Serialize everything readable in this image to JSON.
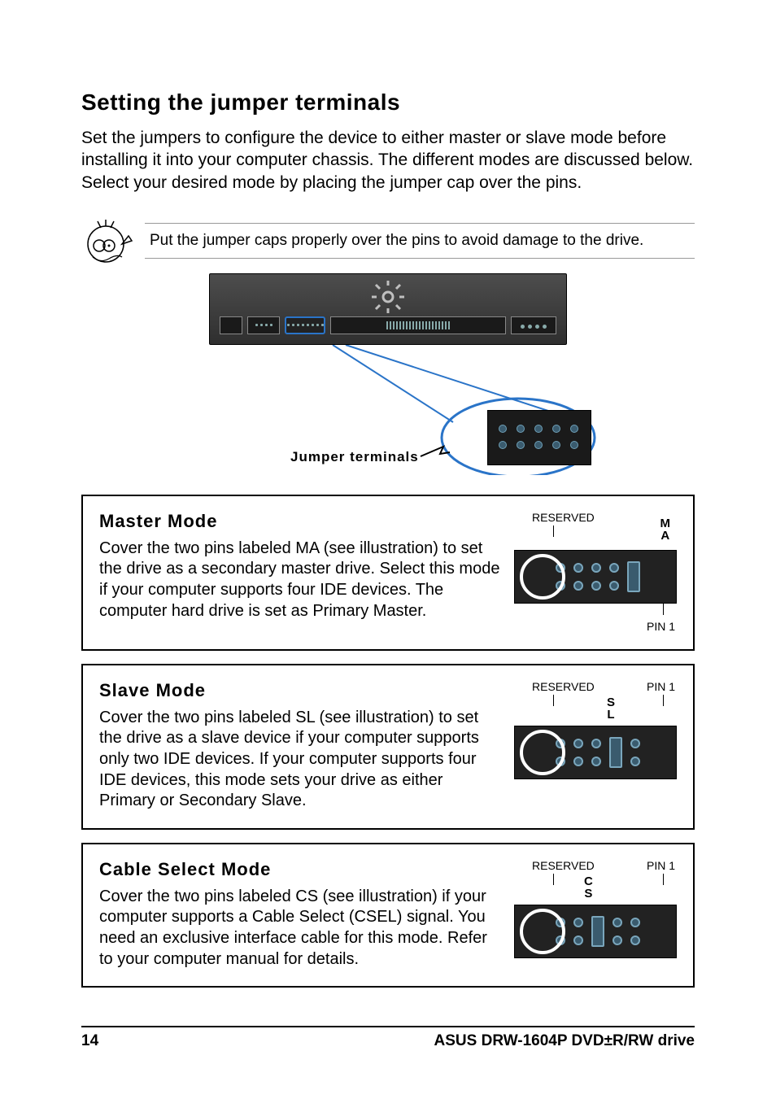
{
  "page": {
    "number": "14",
    "footer_title": "ASUS DRW-1604P DVD±R/RW drive"
  },
  "heading": "Setting the jumper terminals",
  "intro": "Set the jumpers to configure the device to either master or slave mode before installing it into your computer chassis. The different modes are discussed below. Select your desired mode by placing the jumper cap over the pins.",
  "note": "Put the jumper caps properly over the pins to avoid damage to the drive.",
  "figure": {
    "callout_label": "Jumper terminals"
  },
  "labels": {
    "reserved": "RESERVED",
    "pin1": "PIN 1"
  },
  "modes": {
    "master": {
      "title": "Master Mode",
      "body": "Cover the two pins labeled MA (see illustration) to set the drive as a secondary master drive. Select this mode if your computer supports four IDE devices. The computer hard drive is set as Primary Master.",
      "col": {
        "l1": "M",
        "l2": "A"
      }
    },
    "slave": {
      "title": "Slave Mode",
      "body": "Cover the two pins labeled SL (see illustration) to set the drive as a slave device if your computer supports only two IDE devices. If your computer supports four IDE devices, this mode sets your drive as either Primary or Secondary Slave.",
      "col": {
        "l1": "S",
        "l2": "L"
      }
    },
    "cable": {
      "title": "Cable Select Mode",
      "body": "Cover the two pins labeled CS (see illustration) if your computer supports a Cable Select (CSEL) signal. You need an exclusive interface cable for this mode. Refer to your computer manual for details.",
      "col": {
        "l1": "C",
        "l2": "S"
      }
    }
  }
}
